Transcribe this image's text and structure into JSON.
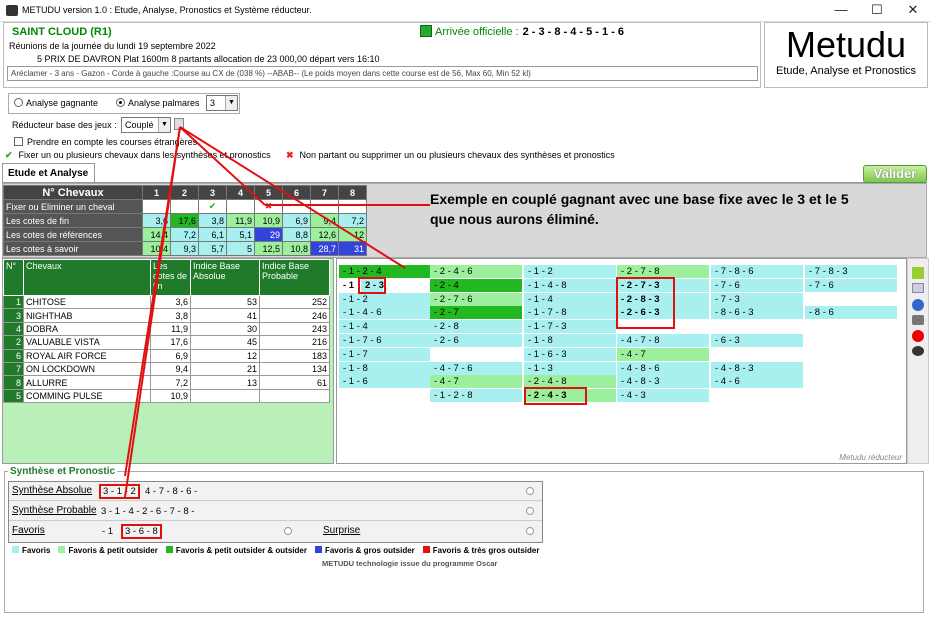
{
  "window": {
    "title": "METUDU version 1.0  : Etude, Analyse,  Pronostics et Système réducteur.",
    "min": "—",
    "max": "☐",
    "close": "✕"
  },
  "header": {
    "hippodrome": "SAINT CLOUD (R1)",
    "reunion": "Réunions de la journée du lundi 19 septembre 2022",
    "course": "5 PRIX DE DAVRON Plat 1600m 8 partants allocation de 23 000,00 départ vers 16:10",
    "arrivee_label": "Arrivée officielle :",
    "arrivee": "2 - 3 - 8 - 4 - 5 - 1 - 6",
    "description": "Aréclamer - 3 ans - Gazon - Corde à gauche :Course au CX de (038 %) --ABAB-- (Le poids moyen dans cette course est de 56, Max 60, Min 52 kl)"
  },
  "logo": {
    "name": "Metudu",
    "tagline": "Etude, Analyse et Pronostics"
  },
  "controls": {
    "analyse_gagnante": "Analyse gagnante",
    "analyse_palmares": "Analyse palmares",
    "palmares_value": "3",
    "reducteur_label": "Réducteur base des jeux :",
    "reducteur_value": "Couplé",
    "etrangeres": "Prendre en compte les courses étrangères",
    "fixer_hint": "Fixer un ou plusieurs chevaux dans les synthèses et pronostics",
    "nonpartant_hint": "Non partant ou supprimer un ou plusieurs chevaux des synthèses et pronostics"
  },
  "tab": {
    "label": "Etude et Analyse"
  },
  "valider": "Valider",
  "horse_grid": {
    "header": "N° Chevaux",
    "numbers": [
      "1",
      "2",
      "3",
      "4",
      "5",
      "6",
      "7",
      "8"
    ],
    "rows": [
      {
        "label": "Fixer ou Eliminer un cheval",
        "cells": [
          "",
          "",
          "✔",
          "",
          "✖",
          "",
          "",
          ""
        ],
        "colors": [
          "c-w",
          "c-w",
          "c-w",
          "c-w",
          "c-w",
          "c-w",
          "c-w",
          "c-w"
        ]
      },
      {
        "label": "Les cotes de fin",
        "cells": [
          "3,6",
          "17,6",
          "3,8",
          "11,9",
          "10,9",
          "6,9",
          "9,4",
          "7,2"
        ],
        "colors": [
          "c-lb",
          "c-g",
          "c-lb",
          "c-lg",
          "c-lg",
          "c-lb",
          "c-lg",
          "c-lb"
        ]
      },
      {
        "label": "Les cotes de références",
        "cells": [
          "14,4",
          "7,2",
          "6,1",
          "5,1",
          "29",
          "8,8",
          "12,6",
          "12"
        ],
        "colors": [
          "c-lg",
          "c-lb",
          "c-lb",
          "c-lb",
          "c-bl",
          "c-lb",
          "c-lg",
          "c-lg"
        ]
      },
      {
        "label": "Les cotes à savoir",
        "cells": [
          "10,4",
          "9,3",
          "5,7",
          "5",
          "12,5",
          "10,8",
          "28,7",
          "31"
        ],
        "colors": [
          "c-lg",
          "c-lb",
          "c-lb",
          "c-lb",
          "c-lg",
          "c-lg",
          "c-bl",
          "c-bl"
        ]
      }
    ]
  },
  "annotation": "Exemple en couplé gagnant avec une base fixe avec le 3 et le 5 que nous aurons éliminé.",
  "analysis_table": {
    "headers": [
      "N°",
      "Chevaux",
      "Les cotes de fin",
      "Indice Base Absolue",
      "Indice Base Probable"
    ],
    "rows": [
      {
        "n": "1",
        "name": "CHITOSE",
        "cote": "3,6",
        "abs": "53",
        "prob": "252",
        "c": "c-lb"
      },
      {
        "n": "3",
        "name": "NIGHTHAB",
        "cote": "3,8",
        "abs": "41",
        "prob": "246",
        "c": "c-lb"
      },
      {
        "n": "4",
        "name": "DOBRA",
        "cote": "11,9",
        "abs": "30",
        "prob": "243",
        "c": "c-lg"
      },
      {
        "n": "2",
        "name": "VALUABLE VISTA",
        "cote": "17,6",
        "abs": "45",
        "prob": "216",
        "c": "c-g"
      },
      {
        "n": "6",
        "name": "ROYAL AIR FORCE",
        "cote": "6,9",
        "abs": "12",
        "prob": "183",
        "c": "c-lb"
      },
      {
        "n": "7",
        "name": "ON LOCKDOWN",
        "cote": "9,4",
        "abs": "21",
        "prob": "134",
        "c": "c-lg"
      },
      {
        "n": "8",
        "name": "ALLURRE",
        "cote": "7,2",
        "abs": "13",
        "prob": "61",
        "c": "c-lb"
      },
      {
        "n": "5",
        "name": "COMMING PULSE",
        "cote": "10,9",
        "abs": "",
        "prob": "",
        "c": "c-lg"
      }
    ]
  },
  "combinations": [
    [
      "- 1 - 2 - 4",
      "- 1",
      "- 1 - 2",
      "- 1 - 4 - 6",
      "- 1 - 4",
      "- 1 - 7 - 6",
      "- 1 - 7",
      "- 1 - 8",
      "- 1 - 6",
      ""
    ],
    [
      "- 2 - 4 - 6",
      "- 2 - 4",
      "- 2 - 7 - 6",
      "- 2 - 7",
      "- 2 - 8",
      "- 2 - 6",
      "",
      "- 4 - 7 - 6",
      "- 4 - 7",
      "- 1 - 2 - 8"
    ],
    [
      "- 1 - 2",
      "- 1 - 4 - 8",
      "- 1 - 4",
      "- 1 - 7 - 8",
      "- 1 - 7 - 3",
      "- 1 - 8",
      "- 1 - 6 - 3",
      "- 1 - 3",
      "- 2 - 4 - 8",
      "- 2 - 4 - 3"
    ],
    [
      "- 2 - 7 - 8",
      "- 2 - 7 - 3",
      "- 2 - 8 - 3",
      "- 2 - 6 - 3",
      "",
      "- 4 - 7 - 8",
      "- 4 - 7",
      "- 4 - 8 - 6",
      "- 4 - 8 - 3",
      "- 4 - 3"
    ],
    [
      "- 7 - 8 - 6",
      "- 7 - 6",
      "- 7 - 3",
      "- 8 - 6 - 3",
      "",
      "- 6 - 3",
      "",
      "- 4 - 8 - 3",
      "- 4 - 6",
      ""
    ],
    [
      "- 7 - 8 - 3",
      "- 7 - 6",
      "",
      "- 8 - 6",
      "",
      "",
      "",
      "",
      "",
      ""
    ]
  ],
  "combo_extra": "2 - 3",
  "metudu_reducteur": "Metudu réducteur",
  "synthese": {
    "title": "Synthèse et Pronostic",
    "absolue_label": "Synthèse Absolue",
    "absolue_hl": "3 - 1 - 2",
    "absolue_rest": "4 - 7 - 8 - 6 -",
    "probable_label": "Synthèse Probable",
    "probable": "3 - 1 - 4 - 2 - 6 - 7 - 8 -",
    "favoris_label": "Favoris",
    "favoris_pre": "- 1",
    "favoris_hl": "3 - 6 - 8",
    "surprise_label": "Surprise"
  },
  "legend": [
    {
      "label": "Favoris",
      "color": "#a8f0f0"
    },
    {
      "label": "Favoris & petit outsider",
      "color": "#9cef9c"
    },
    {
      "label": "Favoris & petit outsider & outsider",
      "color": "#22b822"
    },
    {
      "label": "Favoris & gros outsider",
      "color": "#3344dd"
    },
    {
      "label": "Favoris & très gros outsider",
      "color": "#e01010"
    }
  ],
  "tech": "METUDU technologie issue du programme Oscar"
}
